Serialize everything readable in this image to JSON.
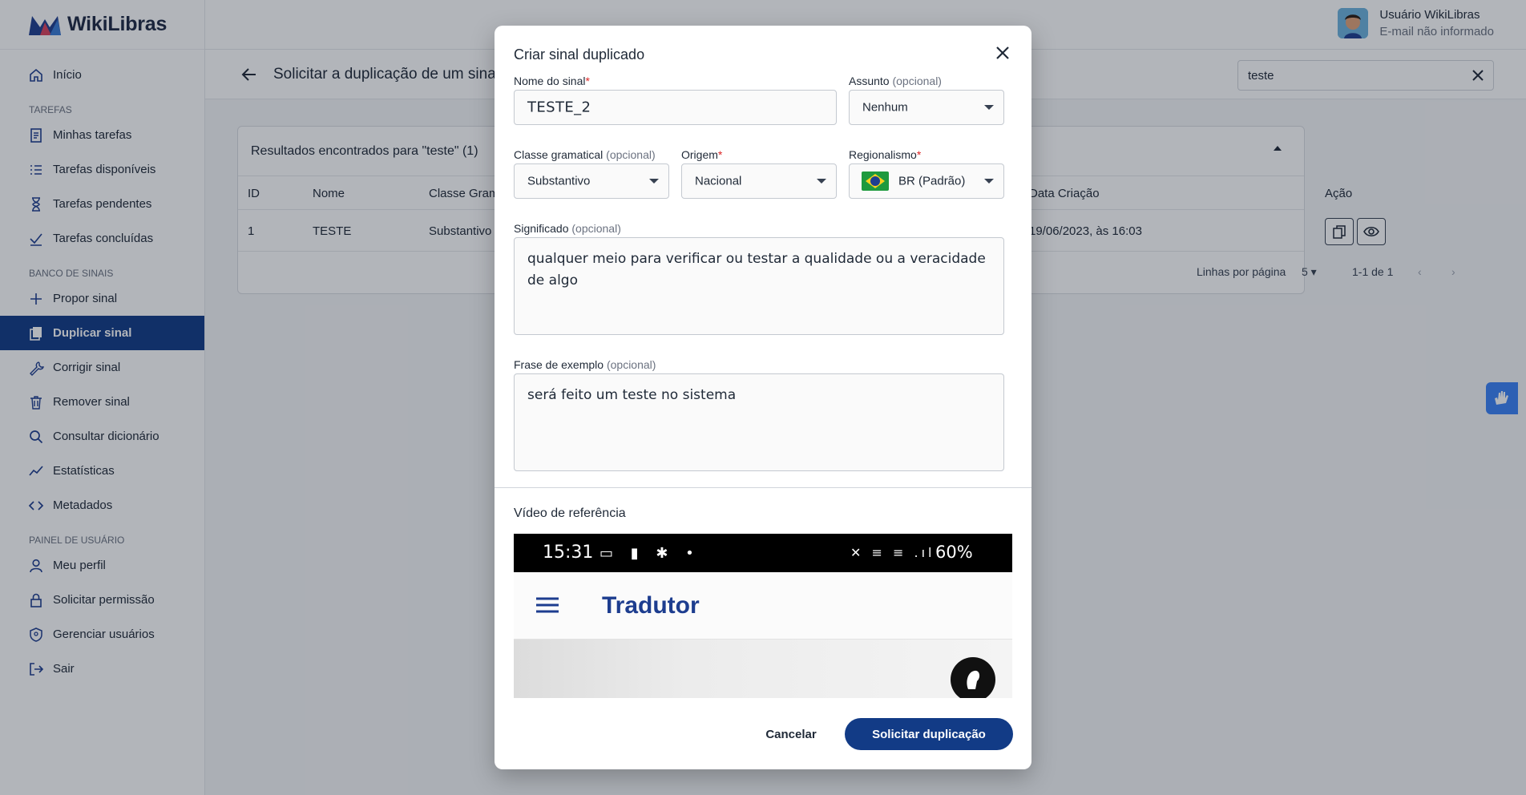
{
  "app": {
    "name": "WikiLibras"
  },
  "user": {
    "name": "Usuário WikiLibras",
    "email": "E-mail não informado"
  },
  "sidebar": {
    "items": [
      {
        "label": "Início"
      },
      {
        "section": "TAREFAS"
      },
      {
        "label": "Minhas tarefas"
      },
      {
        "label": "Tarefas disponíveis"
      },
      {
        "label": "Tarefas pendentes"
      },
      {
        "label": "Tarefas concluídas"
      },
      {
        "section": "BANCO DE SINAIS"
      },
      {
        "label": "Propor sinal"
      },
      {
        "label": "Duplicar sinal"
      },
      {
        "label": "Corrigir sinal"
      },
      {
        "label": "Remover sinal"
      },
      {
        "label": "Consultar dicionário"
      },
      {
        "label": "Estatísticas"
      },
      {
        "label": "Metadados"
      },
      {
        "section": "PAINEL DE USUÁRIO"
      },
      {
        "label": "Meu perfil"
      },
      {
        "label": "Solicitar permissão"
      },
      {
        "label": "Gerenciar usuários"
      },
      {
        "label": "Sair"
      }
    ]
  },
  "page": {
    "title": "Solicitar a duplicação de um sinal",
    "search": {
      "value": "teste"
    }
  },
  "results": {
    "heading": "Resultados encontrados para \"teste\" (1)",
    "columns": [
      "ID",
      "Nome",
      "Classe Gramatical",
      "Data Criação",
      "Ação"
    ],
    "rows": [
      {
        "id": "1",
        "name": "TESTE",
        "class": "Substantivo",
        "date": "19/06/2023, às 16:03"
      }
    ],
    "pagination": {
      "rows_label": "Linhas por página",
      "rows_value": "5",
      "range": "1-1 de 1"
    }
  },
  "modal": {
    "title": "Criar sinal duplicado",
    "fields": {
      "name": {
        "label": "Nome do sinal",
        "required": "*",
        "value": "TESTE_2"
      },
      "subject": {
        "label": "Assunto",
        "optional": "(opcional)",
        "value": "Nenhum"
      },
      "class": {
        "label": "Classe gramatical",
        "optional": "(opcional)",
        "value": "Substantivo"
      },
      "origin": {
        "label": "Origem",
        "required": "*",
        "value": "Nacional"
      },
      "region": {
        "label": "Regionalismo",
        "required": "*",
        "value": "BR (Padrão)"
      },
      "meaning": {
        "label": "Significado",
        "optional": "(opcional)",
        "value": "qualquer meio para verificar ou testar a qualidade ou a veracidade de algo"
      },
      "example": {
        "label": "Frase de exemplo",
        "optional": "(opcional)",
        "value": "será feito um teste no sistema"
      }
    },
    "video": {
      "label": "Vídeo de referência",
      "status_time": "15:31",
      "status_battery": "60%",
      "app_title": "Tradutor"
    },
    "buttons": {
      "cancel": "Cancelar",
      "submit": "Solicitar duplicação"
    }
  },
  "colors": {
    "primary": "#123b86",
    "accent": "#3b82f6",
    "required": "#dc2626"
  }
}
